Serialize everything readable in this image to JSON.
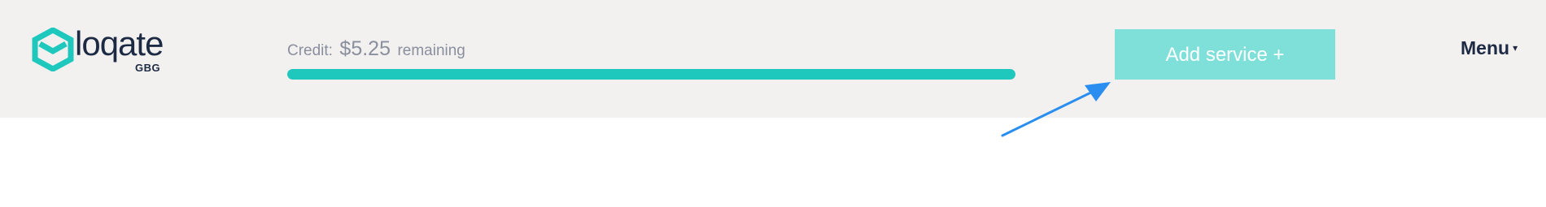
{
  "logo": {
    "wordmark": "loqate",
    "sub": "GBG",
    "icon": "loqate-hexagon-logo",
    "color": "#1fc8bd"
  },
  "credit": {
    "label": "Credit:",
    "amount": "$5.25",
    "suffix": "remaining",
    "progress_fraction": 1.0,
    "bar_color": "#1fc8bd"
  },
  "actions": {
    "add_service_label": "Add service +",
    "add_service_color": "#7fe0da",
    "menu_label": "Menu",
    "menu_caret": "▾"
  },
  "annotation": {
    "icon": "arrow-pointer-icon",
    "color": "#2a8ef0"
  }
}
